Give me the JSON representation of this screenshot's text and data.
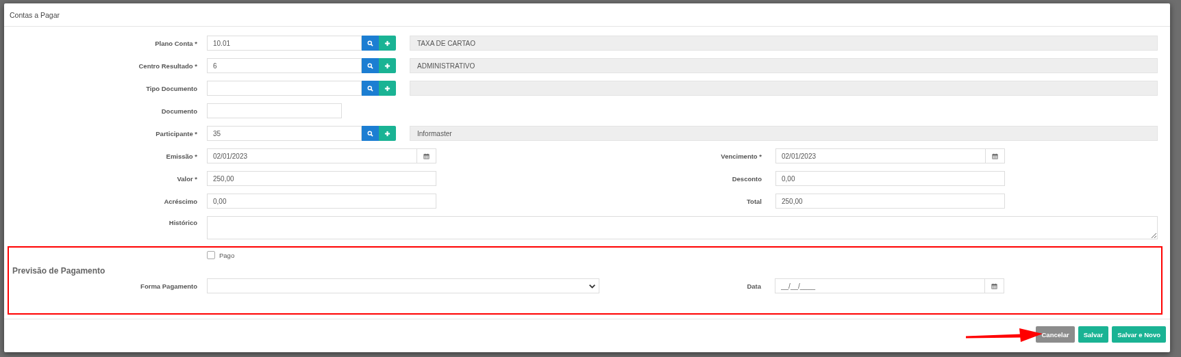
{
  "window": {
    "title": "Contas a Pagar"
  },
  "rows": [
    {
      "kind": "lookup",
      "label": "Plano Conta *",
      "value": "10.01",
      "description": "TAXA DE CARTAO"
    },
    {
      "kind": "lookup",
      "label": "Centro Resultado *",
      "value": "6",
      "description": "ADMINISTRATIVO"
    },
    {
      "kind": "lookup",
      "label": "Tipo Documento"
    },
    {
      "kind": "text",
      "label": "Documento"
    },
    {
      "kind": "lookup",
      "label": "Participante *",
      "value": "35",
      "description": "Informaster"
    },
    {
      "kind": "pair",
      "left": {
        "kind": "date",
        "label": "Emissão *",
        "value": "02/01/2023"
      },
      "right": {
        "kind": "date",
        "label": "Vencimento *",
        "value": "02/01/2023"
      }
    },
    {
      "kind": "pair",
      "left": {
        "kind": "money",
        "label": "Valor *",
        "value": "250,00"
      },
      "right": {
        "kind": "money",
        "label": "Desconto",
        "value": "0,00"
      }
    },
    {
      "kind": "pair",
      "left": {
        "kind": "money",
        "label": "Acréscimo",
        "value": "0,00"
      },
      "right": {
        "kind": "money",
        "label": "Total",
        "value": "250,00"
      }
    },
    {
      "kind": "textarea",
      "label": "Histórico"
    }
  ],
  "payment_section": {
    "title": "Previsão de Pagamento",
    "highlighted": true,
    "paid": {
      "label": "Pago",
      "checked": false
    },
    "method": {
      "kind": "select",
      "label": "Forma Pagamento"
    },
    "date": {
      "kind": "date",
      "label": "Data",
      "placeholder": "__/__/____"
    }
  },
  "buttons": [
    {
      "label": "Cancelar",
      "kind": "secondary"
    },
    {
      "label": "Salvar",
      "kind": "primary"
    },
    {
      "label": "Salvar e Novo",
      "kind": "primary"
    }
  ],
  "annotations": [
    {
      "kind": "arrow"
    }
  ]
}
